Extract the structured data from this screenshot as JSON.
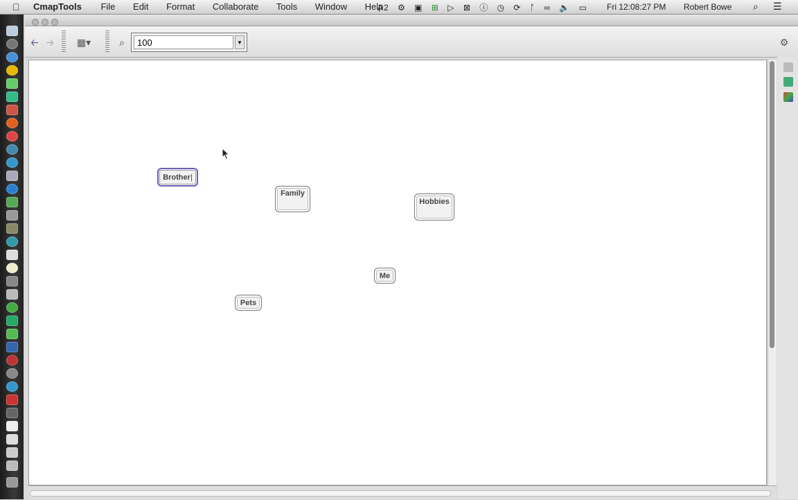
{
  "menubar": {
    "apple": "",
    "app_name": "CmapTools",
    "menus": [
      "File",
      "Edit",
      "Format",
      "Collaborate",
      "Tools",
      "Window",
      "Help"
    ],
    "status_badge": "2",
    "clock": "Fri 12:08:27 PM",
    "user": "Robert Bowe"
  },
  "window": {
    "title": ""
  },
  "toolbar": {
    "zoom_value": "100"
  },
  "concepts": [
    {
      "label": "Brother",
      "selected": true
    },
    {
      "label": "Family"
    },
    {
      "label": "Hobbies"
    },
    {
      "label": "Me"
    },
    {
      "label": "Pets"
    }
  ],
  "colors": {
    "selection": "#6b5fb5",
    "dock": "#2a2a2a"
  }
}
